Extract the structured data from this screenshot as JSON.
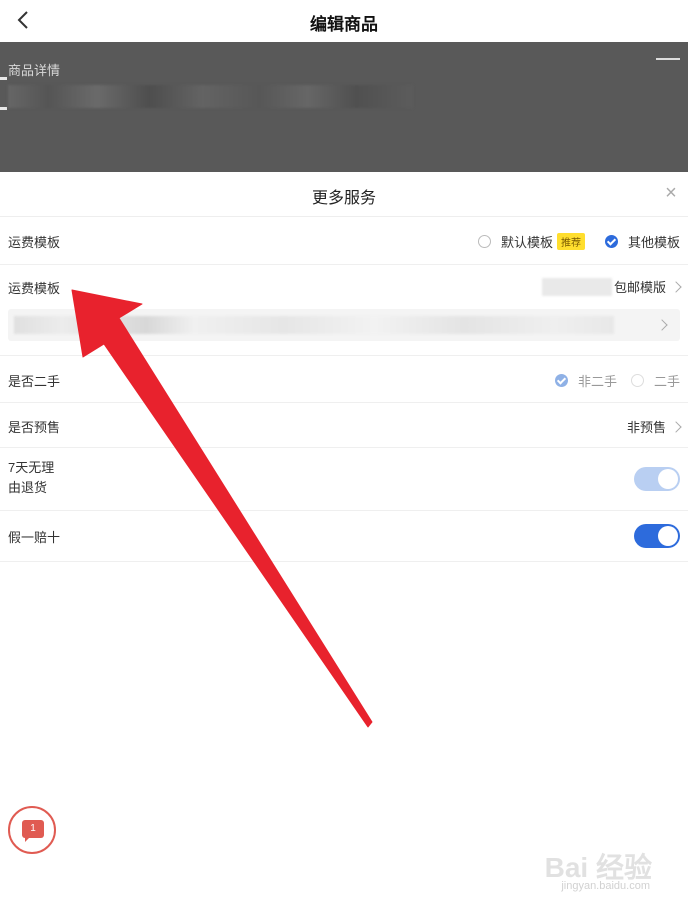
{
  "header": {
    "title": "编辑商品"
  },
  "background": {
    "section_label": "商品详情"
  },
  "sheet": {
    "title": "更多服务",
    "close_glyph": "×",
    "rows": {
      "shipping_template_mode": {
        "label": "运费模板",
        "option_default": "默认模板",
        "badge": "推荐",
        "option_other": "其他模板",
        "selected": "其他模板"
      },
      "shipping_template": {
        "label": "运费模板",
        "value": "包邮模版"
      },
      "second_hand": {
        "label": "是否二手",
        "option_no": "非二手",
        "option_yes": "二手",
        "selected": "非二手"
      },
      "presale": {
        "label": "是否预售",
        "value": "非预售"
      },
      "return_policy": {
        "label_line1": "7天无理",
        "label_line2": "由退货",
        "enabled": true,
        "locked": true
      },
      "fake_compensation": {
        "label": "假一赔十",
        "enabled": true
      }
    }
  },
  "chat": {
    "badge_count": "1"
  },
  "watermark": {
    "text": "Bai 经验",
    "sub": "jingyan.baidu.com"
  },
  "colors": {
    "accent_blue": "#2d6bdc",
    "arrow_red": "#e8222d",
    "badge_yellow": "#ffde2e",
    "overlay_gray": "#595959"
  }
}
